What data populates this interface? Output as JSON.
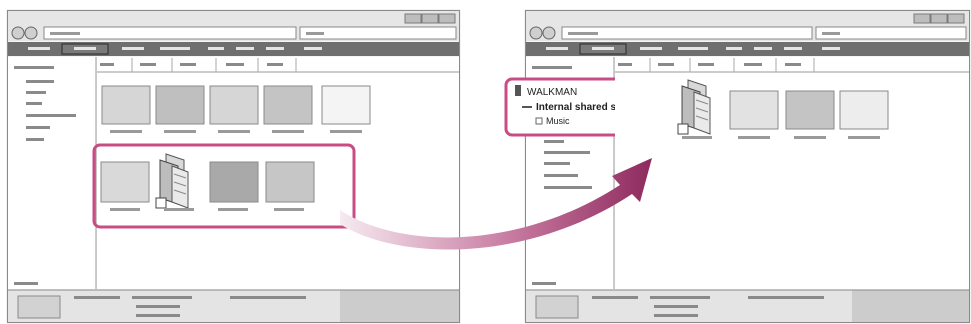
{
  "left_window": {
    "thumbnails_top": [
      "light",
      "mid",
      "light",
      "mid",
      "white"
    ],
    "thumbnails_selected": [
      "light",
      "folder",
      "dark",
      "mid"
    ]
  },
  "right_window": {
    "device_tree": {
      "device_label": "WALKMAN",
      "storage_label": "Internal shared storage",
      "folder_label": "Music"
    },
    "thumbnails_top": [
      "folder",
      "light",
      "mid",
      "white"
    ]
  },
  "colors": {
    "highlight_border": "#c84d84",
    "arrow_start": "#f4e4ec",
    "arrow_end": "#8e2a5e",
    "window_border": "#8a8a8a",
    "menubar": "#6f6f6f",
    "statusbar": "#d9d9d9"
  },
  "icons": [
    "folder-icon",
    "walkman-device-icon",
    "folder-minus-icon",
    "folder-square-icon"
  ]
}
